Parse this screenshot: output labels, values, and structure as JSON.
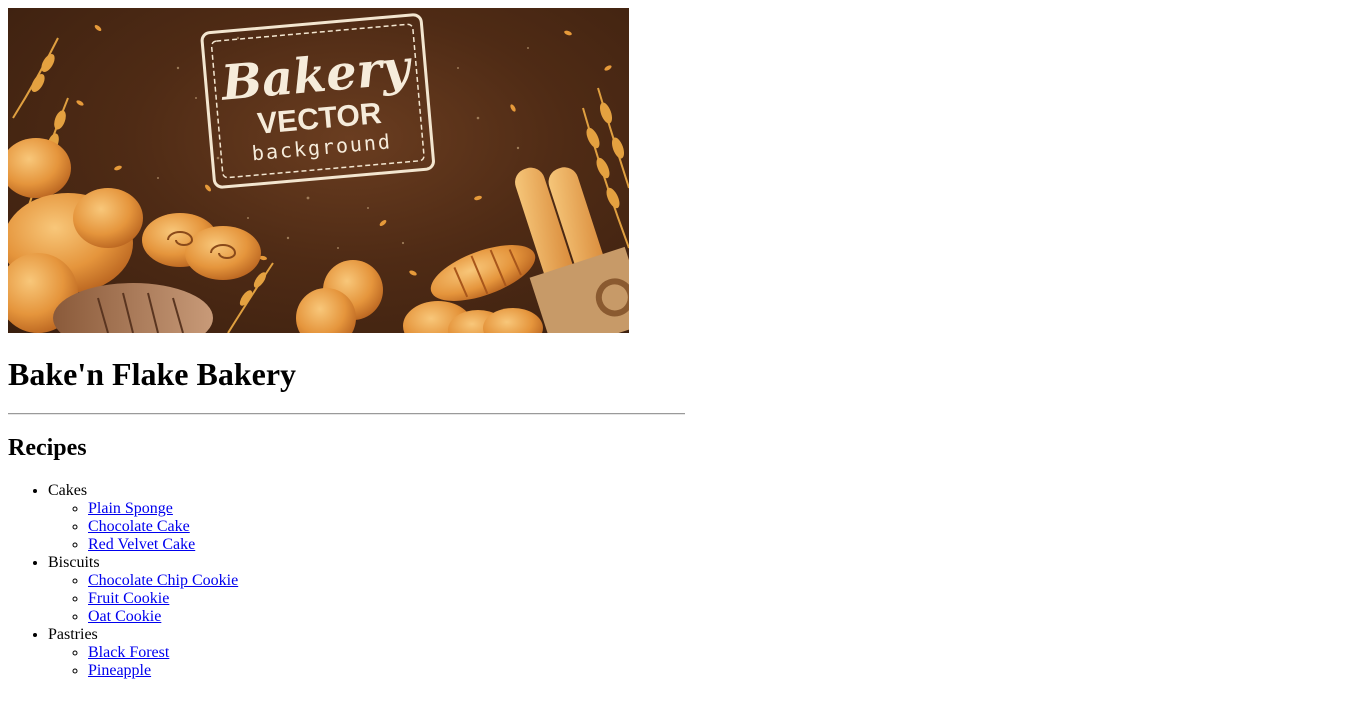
{
  "banner": {
    "logo_text_line1": "Bakery",
    "logo_text_line2": "VECTOR",
    "logo_text_line3": "background"
  },
  "header": {
    "title": "Bake'n Flake Bakery"
  },
  "recipes": {
    "heading": "Recipes",
    "categories": [
      {
        "name": "Cakes",
        "items": [
          "Plain Sponge",
          "Chocolate Cake",
          "Red Velvet Cake"
        ]
      },
      {
        "name": "Biscuits",
        "items": [
          "Chocolate Chip Cookie",
          "Fruit Cookie",
          "Oat Cookie"
        ]
      },
      {
        "name": "Pastries",
        "items": [
          "Black Forest",
          "Pineapple"
        ]
      }
    ]
  },
  "colors": {
    "link": "#0000ee",
    "text": "#000000",
    "banner_bg": "#4f2b15",
    "banner_bread": "#e8a04a"
  }
}
